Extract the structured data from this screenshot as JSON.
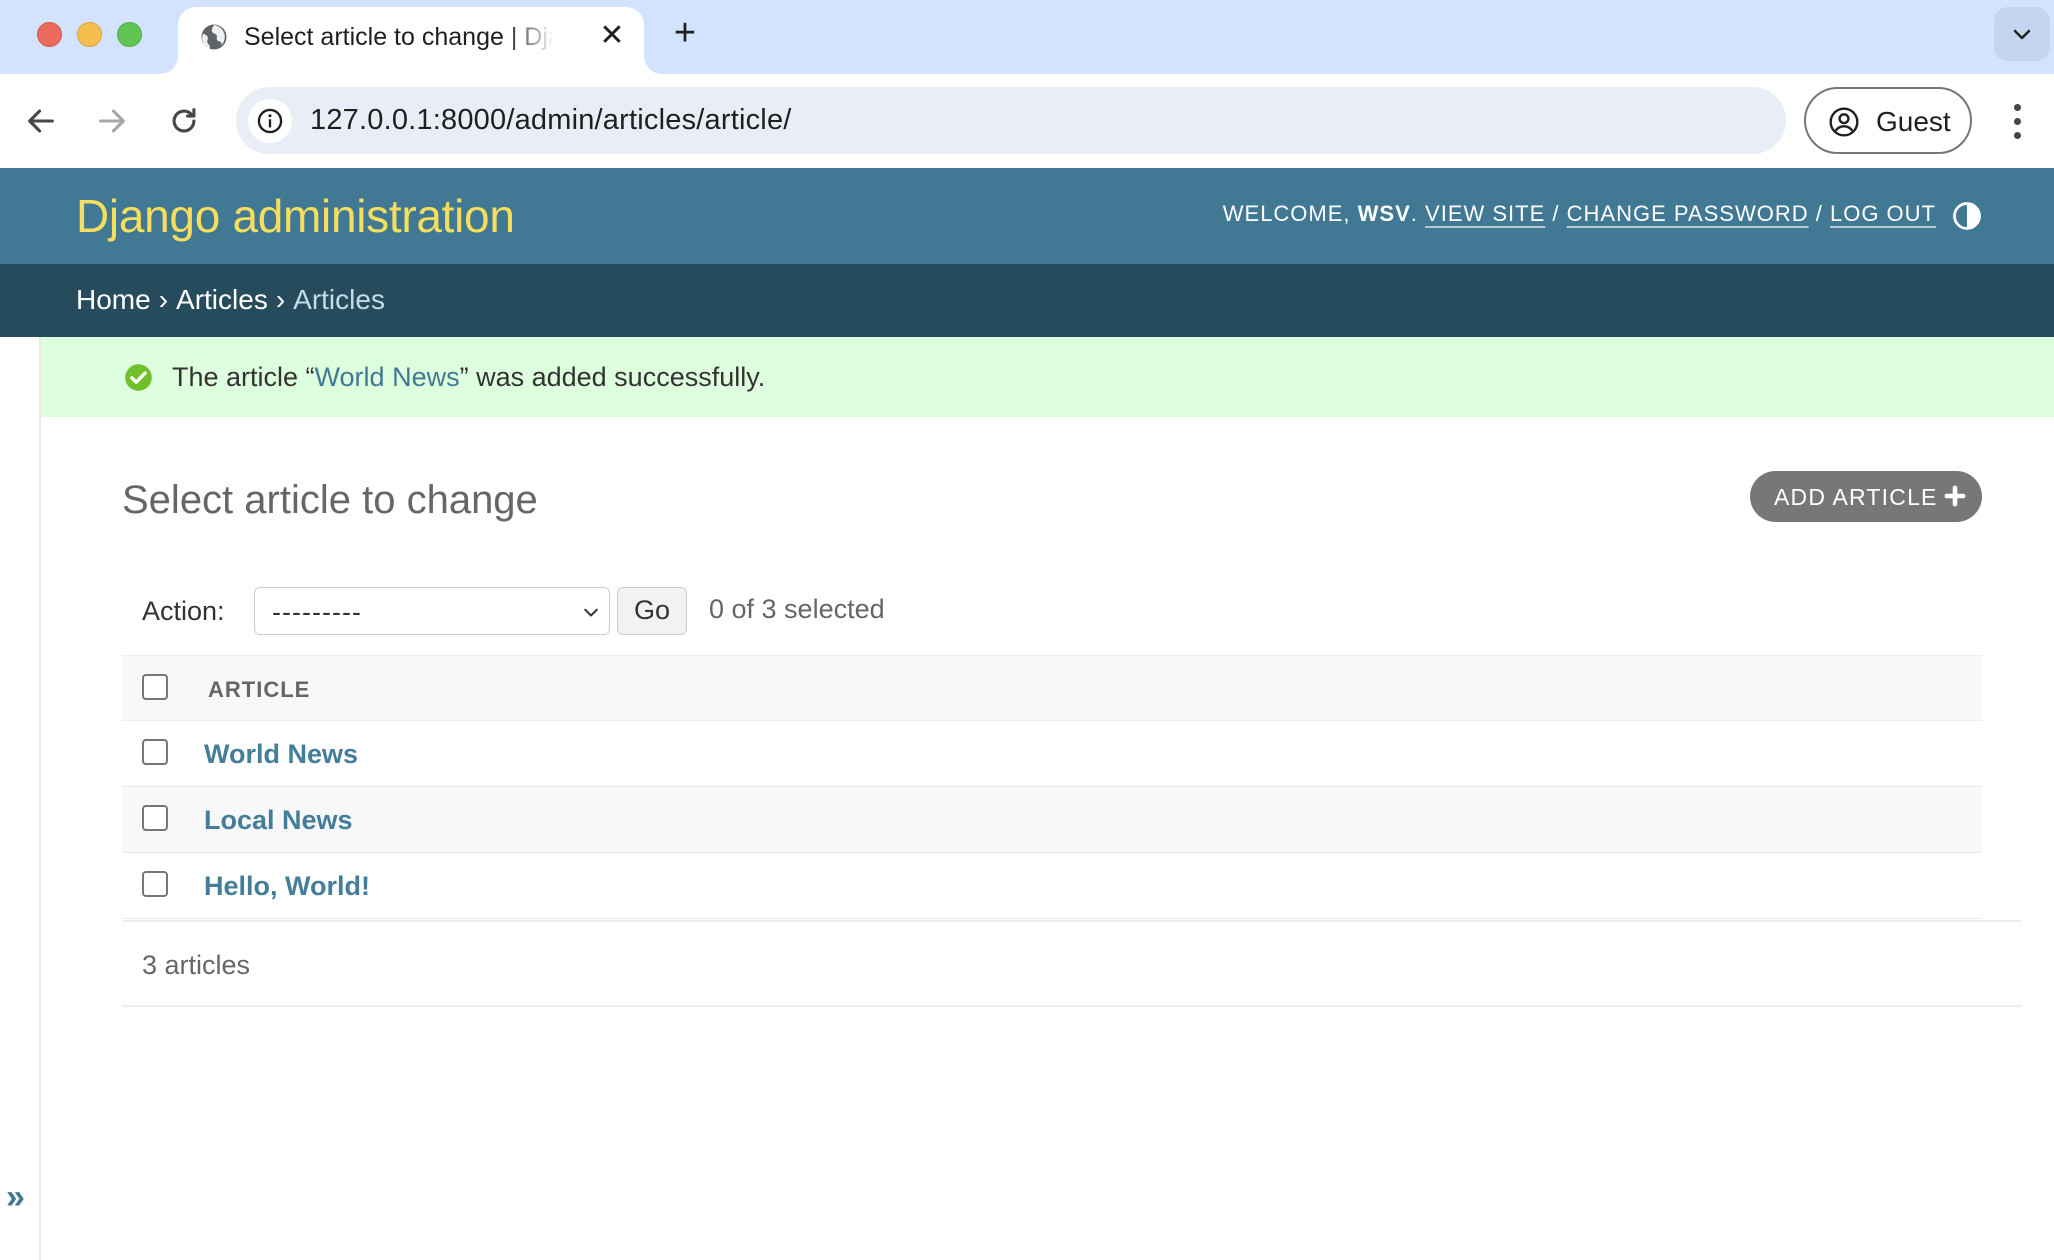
{
  "browser": {
    "tab": {
      "title": "Select article to change | Django site admin"
    },
    "new_tab_symbol": "+",
    "close_symbol": "✕",
    "url": "127.0.0.1:8000/admin/articles/article/",
    "profile_label": "Guest"
  },
  "header": {
    "branding": "Django administration",
    "welcome_prefix": "WELCOME,",
    "username": "WSV",
    "view_site": "VIEW SITE",
    "change_password": "CHANGE PASSWORD",
    "log_out": "LOG OUT",
    "separator": "/"
  },
  "breadcrumbs": {
    "home": "Home",
    "app": "Articles",
    "current": "Articles",
    "separator": "›"
  },
  "message": {
    "prefix": "The article “",
    "link": "World News",
    "suffix": "” was added successfully."
  },
  "content": {
    "title": "Select article to change",
    "add_button": "ADD ARTICLE"
  },
  "actions": {
    "label": "Action:",
    "selected_option": "---------",
    "go_button": "Go",
    "counter": "0 of 3 selected"
  },
  "table": {
    "column_header": "ARTICLE",
    "rows": [
      {
        "title": "World News"
      },
      {
        "title": "Local News"
      },
      {
        "title": "Hello, World!"
      }
    ]
  },
  "paginator": {
    "count_text": "3 articles"
  },
  "sidebar": {
    "toggle_symbol": "»"
  },
  "colors": {
    "header_bg": "#417893",
    "branding": "#f5dd5d",
    "breadcrumbs_bg": "#264b5d",
    "success_bg": "#ddffdd",
    "link": "#447e9b",
    "success_icon": "#70bf2b"
  },
  "icons": {
    "tab_favicon": "globe-icon",
    "site_info": "info-icon",
    "profile": "account-circle-icon",
    "theme_toggle": "half-circle-contrast-icon",
    "success": "check-circle-icon",
    "add": "plus-icon"
  }
}
